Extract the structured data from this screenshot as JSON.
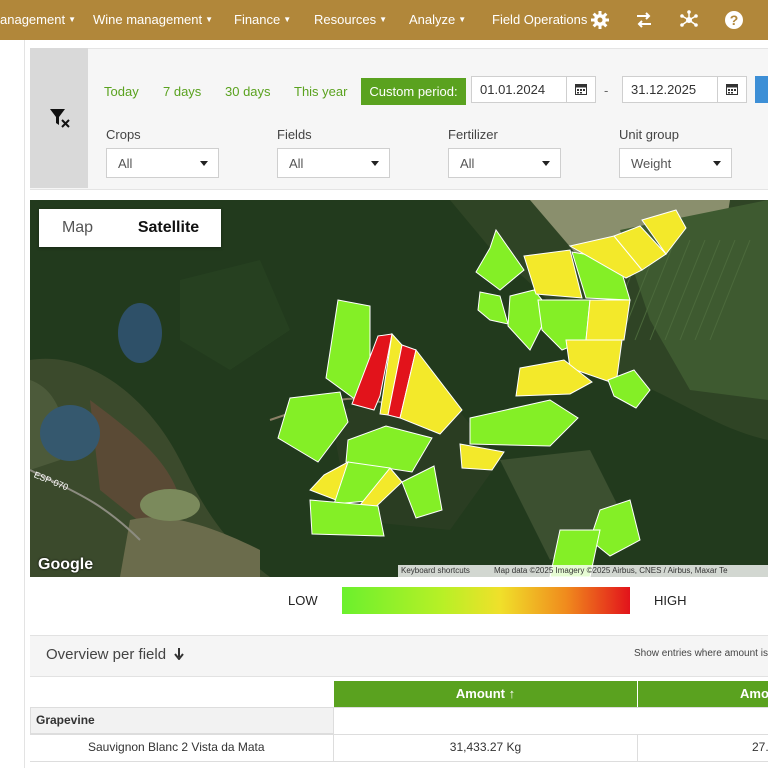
{
  "nav": {
    "items": [
      {
        "label": "anagement",
        "caret": true
      },
      {
        "label": "Wine management",
        "caret": true
      },
      {
        "label": "Finance",
        "caret": true
      },
      {
        "label": "Resources",
        "caret": true
      },
      {
        "label": "Analyze",
        "caret": true
      },
      {
        "label": "Field Operations",
        "caret": false
      }
    ],
    "icons": [
      "gear-icon",
      "swap-arrows-icon",
      "network-icon",
      "help-icon"
    ],
    "background": "#b1873a"
  },
  "filters": {
    "clear_icon": "filter-clear-icon",
    "quick_periods": [
      "Today",
      "7 days",
      "30 days",
      "This year"
    ],
    "custom_period_label": "Custom period:",
    "date_from": "01.01.2024",
    "date_to": "31.12.2025",
    "separator": "-",
    "selects": [
      {
        "label": "Crops",
        "value": "All"
      },
      {
        "label": "Fields",
        "value": "All"
      },
      {
        "label": "Fertilizer",
        "value": "All"
      },
      {
        "label": "Unit group",
        "value": "Weight"
      }
    ]
  },
  "map": {
    "tabs": [
      "Map",
      "Satellite"
    ],
    "active_tab": "Satellite",
    "google_logo": "Google",
    "road_label": "ESP-070",
    "attribution": {
      "shortcuts": "Keyboard shortcuts",
      "data": "Map data ©2025 Imagery ©2025 Airbus, CNES / Airbus, Maxar Te"
    }
  },
  "legend": {
    "low": "LOW",
    "high": "HIGH",
    "colors": [
      "#6bf02d",
      "#f0e02a",
      "#e2131b"
    ]
  },
  "overview": {
    "title": "Overview per field",
    "sort_icon": "arrow-down-icon",
    "note": "Show entries where amount is",
    "columns": [
      "Amount ↑",
      "Amo"
    ],
    "group": "Grapevine",
    "rows": [
      {
        "field": "Sauvignon Blanc 2 Vista da Mata",
        "amount": "31,433.27 Kg",
        "amount2": "27."
      }
    ]
  }
}
